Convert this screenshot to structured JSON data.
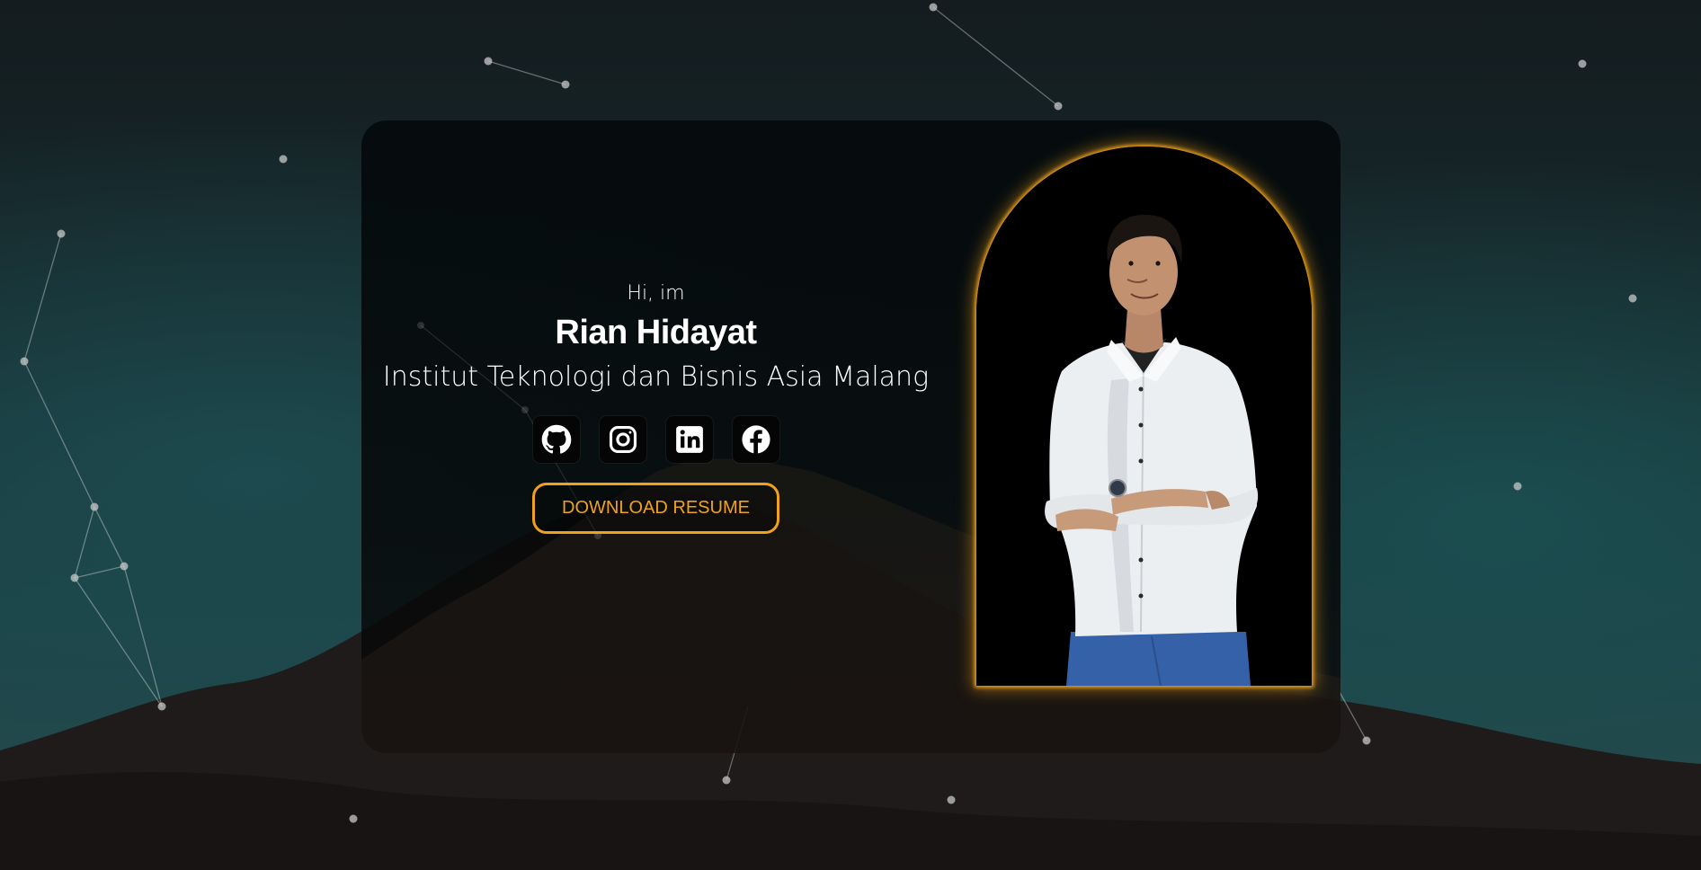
{
  "hero": {
    "greeting": "Hi, im",
    "name": "Rian Hidayat",
    "institution": "Institut Teknologi dan Bisnis Asia Malang",
    "download_label": "DOWNLOAD RESUME"
  },
  "socials": [
    {
      "icon": "github-icon",
      "label": "GitHub"
    },
    {
      "icon": "instagram-icon",
      "label": "Instagram"
    },
    {
      "icon": "linkedin-icon",
      "label": "LinkedIn"
    },
    {
      "icon": "facebook-icon",
      "label": "Facebook"
    }
  ],
  "colors": {
    "accent": "#f0a21c",
    "text": "#ffffff",
    "card": "#050a0c"
  }
}
